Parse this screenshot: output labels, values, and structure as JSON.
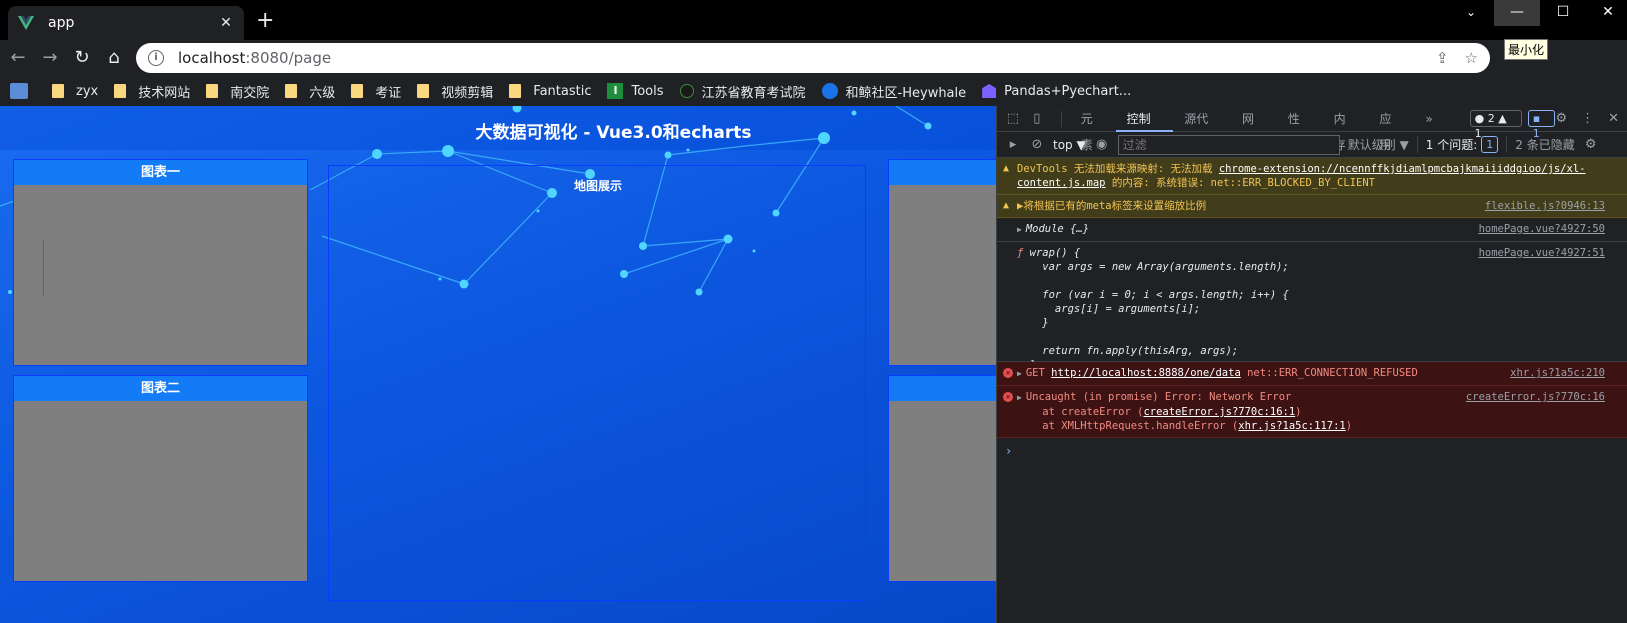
{
  "browser": {
    "tab_title": "app",
    "new_tab": "+",
    "tooltip": "最小化",
    "url_host": "localhost",
    "url_path": ":8080/page",
    "win_chevron": "⌄",
    "win_min": "—",
    "win_max": "☐",
    "win_close": "✕"
  },
  "bookmarks": [
    {
      "label": "zyx",
      "icon": "folder"
    },
    {
      "label": "技术网站",
      "icon": "folder"
    },
    {
      "label": "南交院",
      "icon": "folder"
    },
    {
      "label": "六级",
      "icon": "folder"
    },
    {
      "label": "考证",
      "icon": "folder"
    },
    {
      "label": "视频剪辑",
      "icon": "folder"
    },
    {
      "label": "Fantastic",
      "icon": "folder"
    },
    {
      "label": "Tools",
      "icon": "tools"
    },
    {
      "label": "江苏省教育考试院",
      "icon": "site"
    },
    {
      "label": "和鲸社区-Heywhale",
      "icon": "whale"
    },
    {
      "label": "Pandas+Pyechart...",
      "icon": "pyechart"
    }
  ],
  "page": {
    "title": "大数据可视化 - Vue3.0和echarts",
    "panel1_title": "图表一",
    "panel2_title": "图表二",
    "map_title": "地图展示"
  },
  "devtools": {
    "tabs": [
      "元素",
      "控制台",
      "源代码",
      "网络",
      "性能",
      "内存",
      "应用"
    ],
    "active_tab": "控制台",
    "more": "»",
    "badge_errors": "● 2",
    "badge_warnings": "▲ 1",
    "badge_info": "1",
    "context": "top ▼",
    "filter_placeholder": "过滤",
    "levels": "默认级别 ▼",
    "issues_label": "1 个问题:",
    "issues_count": "1",
    "hidden": "2 条已隐藏"
  },
  "console": {
    "warn1_text_a": "DevTools 无法加载来源映射: 无法加载 ",
    "warn1_link": "chrome-extension://ncennffkjdiamlpmcbajkmaiiiddgioo/js/xl-content.js.map",
    "warn1_text_b": " 的内容: 系统错误: net::ERR_BLOCKED_BY_CLIENT",
    "warn2_text": "▶将根据已有的meta标签来设置缩放比例",
    "warn2_src": "flexible.js?0946:13",
    "log1_text": "Module {…}",
    "log1_src": "homePage.vue?4927:50",
    "log2_src": "homePage.vue?4927:51",
    "log2_code": "wrap() {\n    var args = new Array(arguments.length);\n\n    for (var i = 0; i < args.length; i++) {\n      args[i] = arguments[i];\n    }\n\n    return fn.apply(thisArg, args);\n  }",
    "err1_method": "GET ",
    "err1_url": "http://localhost:8888/one/data",
    "err1_text": " net::ERR_CONNECTION_REFUSED",
    "err1_src": "xhr.js?1a5c:210",
    "err2_text": "Uncaught (in promise) Error: Network Error",
    "err2_src": "createError.js?770c:16",
    "err2_line1_a": "    at createError (",
    "err2_line1_link": "createError.js?770c:16:1",
    "err2_line2_a": "    at XMLHttpRequest.handleError (",
    "err2_line2_link": "xhr.js?1a5c:117:1",
    "close_paren": ")",
    "prompt": "›"
  }
}
